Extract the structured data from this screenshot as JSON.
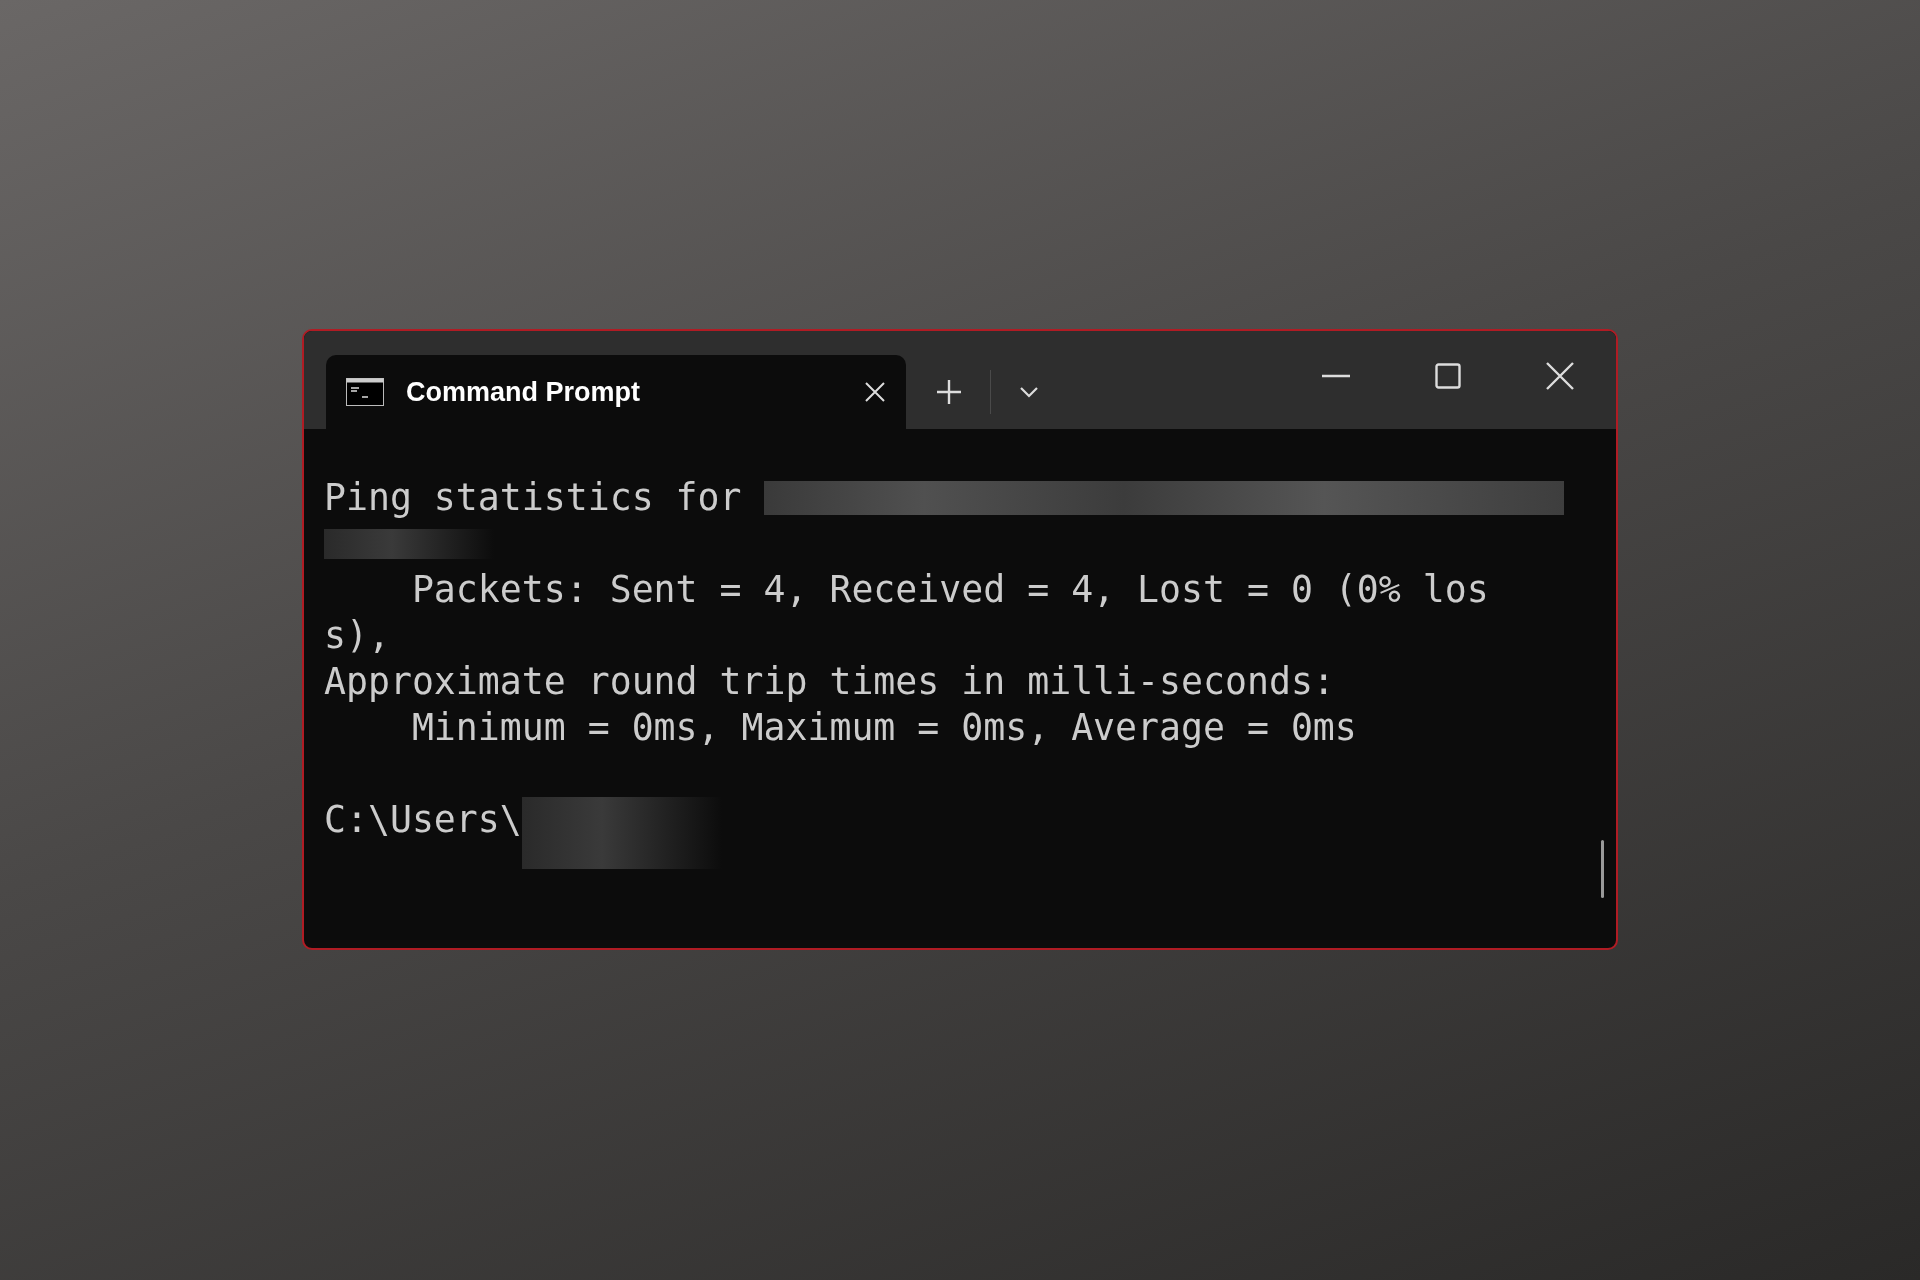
{
  "window": {
    "tab": {
      "title": "Command Prompt",
      "selected": true
    }
  },
  "terminal": {
    "lines": [
      {
        "kind": "blank"
      },
      {
        "kind": "text_redacted",
        "text": "Ping statistics for"
      },
      {
        "kind": "redacted"
      },
      {
        "kind": "text",
        "text": "    Packets: Sent = 4, Received = 4, Lost = 0 (0% los"
      },
      {
        "kind": "text",
        "text": "s),"
      },
      {
        "kind": "text",
        "text": "Approximate round trip times in milli-seconds:"
      },
      {
        "kind": "text",
        "text": "    Minimum = 0ms, Maximum = 0ms, Average = 0ms"
      },
      {
        "kind": "blank"
      },
      {
        "kind": "prompt",
        "text": "C:\\Users\\"
      }
    ]
  }
}
